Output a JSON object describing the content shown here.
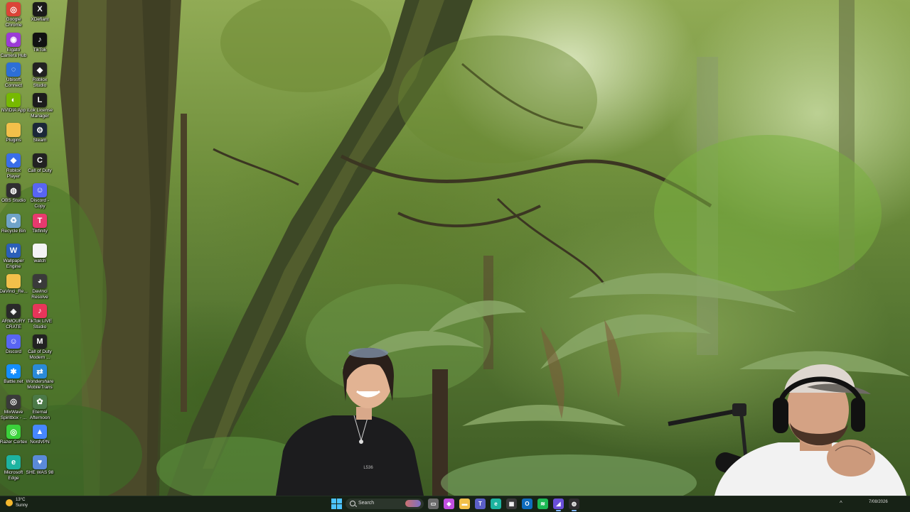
{
  "desktop": {
    "icons": [
      {
        "label": "Google Chrome",
        "icon": "chrome-icon",
        "color": "#db4437",
        "glyph": "◎"
      },
      {
        "label": "XDefiant",
        "icon": "xdefiant-icon",
        "color": "#1a1a1a",
        "glyph": "X"
      },
      {
        "label": "Elgato Camera Hub",
        "icon": "elgato-icon",
        "color": "#9b3bd6",
        "glyph": "◉"
      },
      {
        "label": "TikTok",
        "icon": "tiktok-icon",
        "color": "#111111",
        "glyph": "♪"
      },
      {
        "label": "Ubisoft Connect",
        "icon": "ubisoft-icon",
        "color": "#2d6fd6",
        "glyph": "◌"
      },
      {
        "label": "Roblox Studio",
        "icon": "roblox-studio-icon",
        "color": "#222222",
        "glyph": "◆"
      },
      {
        "label": "NVIDIA App",
        "icon": "nvidia-icon",
        "color": "#76b900",
        "glyph": "◐"
      },
      {
        "label": "iLok License Manager",
        "icon": "ilok-icon",
        "color": "#1c1c1c",
        "glyph": "L"
      },
      {
        "label": "Plugins",
        "icon": "folder-icon",
        "color": "#f2c04a",
        "glyph": ""
      },
      {
        "label": "Steam",
        "icon": "steam-icon",
        "color": "#1b2838",
        "glyph": "⚙"
      },
      {
        "label": "Roblox Player",
        "icon": "roblox-player-icon",
        "color": "#3a6ee8",
        "glyph": "◆"
      },
      {
        "label": "Call of Duty",
        "icon": "call-of-duty-icon",
        "color": "#222222",
        "glyph": "C"
      },
      {
        "label": "OBS Studio",
        "icon": "obs-icon",
        "color": "#302e31",
        "glyph": "◍"
      },
      {
        "label": "Discord - Copy",
        "icon": "discord-copy-icon",
        "color": "#5865f2",
        "glyph": "☺"
      },
      {
        "label": "Recycle Bin",
        "icon": "recycle-bin-icon",
        "color": "#6fa3c8",
        "glyph": "♻"
      },
      {
        "label": "Tikfinity",
        "icon": "tikfinity-icon",
        "color": "#e83a6e",
        "glyph": "T"
      },
      {
        "label": "Wallpaper Engine",
        "icon": "wallpaper-engine-icon",
        "color": "#2b5fb8",
        "glyph": "W"
      },
      {
        "label": "watch",
        "icon": "text-file-icon",
        "color": "#f4f4f4",
        "glyph": ""
      },
      {
        "label": "DaVinci_Re...",
        "icon": "folder-icon",
        "color": "#f2c04a",
        "glyph": ""
      },
      {
        "label": "Davinci Resolve",
        "icon": "davinci-resolve-icon",
        "color": "#3a3a3a",
        "glyph": "◕"
      },
      {
        "label": "ARMOURY CRATE",
        "icon": "armoury-crate-icon",
        "color": "#2a2a2a",
        "glyph": "◈"
      },
      {
        "label": "TikTok LIVE Studio",
        "icon": "tiktok-live-icon",
        "color": "#e8355a",
        "glyph": "♪"
      },
      {
        "label": "Discord",
        "icon": "discord-icon",
        "color": "#5865f2",
        "glyph": "☺"
      },
      {
        "label": "Call of Duty Modern ...",
        "icon": "cod-modern-icon",
        "color": "#222222",
        "glyph": "M"
      },
      {
        "label": "Battle.net",
        "icon": "battlenet-icon",
        "color": "#148eff",
        "glyph": "✱"
      },
      {
        "label": "Wondershare MobileTrans",
        "icon": "mobiletrans-icon",
        "color": "#2a8ad8",
        "glyph": "⇄"
      },
      {
        "label": "MixWave Spiritbox - ...",
        "icon": "mixwave-icon",
        "color": "#3a3a3a",
        "glyph": "◎"
      },
      {
        "label": "Eternal Afternoon",
        "icon": "eternal-afternoon-icon",
        "color": "#4c7a48",
        "glyph": "✿"
      },
      {
        "label": "Razer Cortex",
        "icon": "razer-cortex-icon",
        "color": "#3bd13b",
        "glyph": "◎"
      },
      {
        "label": "NordVPN",
        "icon": "nordvpn-icon",
        "color": "#4687ff",
        "glyph": "▲"
      },
      {
        "label": "Microsoft Edge",
        "icon": "edge-icon",
        "color": "#1db3a0",
        "glyph": "e"
      },
      {
        "label": "SHE WAS 98",
        "icon": "she-was-98-icon",
        "color": "#5a8ad8",
        "glyph": "♥"
      }
    ]
  },
  "taskbar": {
    "weather": {
      "temp": "13°C",
      "condition": "Sunny"
    },
    "search_placeholder": "Search",
    "apps": [
      {
        "name": "file-explorer-task-view-icon",
        "color": "#6a6a6a",
        "glyph": "▭",
        "active": false
      },
      {
        "name": "copilot-icon",
        "color": "#c24fe0",
        "glyph": "◆",
        "active": false
      },
      {
        "name": "file-explorer-icon",
        "color": "#f2c04a",
        "glyph": "▬",
        "active": false
      },
      {
        "name": "teams-icon",
        "color": "#5b5fc7",
        "glyph": "T",
        "active": false
      },
      {
        "name": "edge-icon",
        "color": "#1db3a0",
        "glyph": "e",
        "active": false
      },
      {
        "name": "calculator-icon",
        "color": "#3a3a3a",
        "glyph": "▦",
        "active": false
      },
      {
        "name": "outlook-icon",
        "color": "#0f6cbd",
        "glyph": "O",
        "active": false
      },
      {
        "name": "spotify-icon",
        "color": "#1db954",
        "glyph": "≋",
        "active": false
      },
      {
        "name": "streaming-app-icon",
        "color": "#6a4fd8",
        "glyph": "◢",
        "active": true
      },
      {
        "name": "obs-icon",
        "color": "#302e31",
        "glyph": "◍",
        "active": true
      }
    ],
    "clock_date": "7/08/2026"
  }
}
